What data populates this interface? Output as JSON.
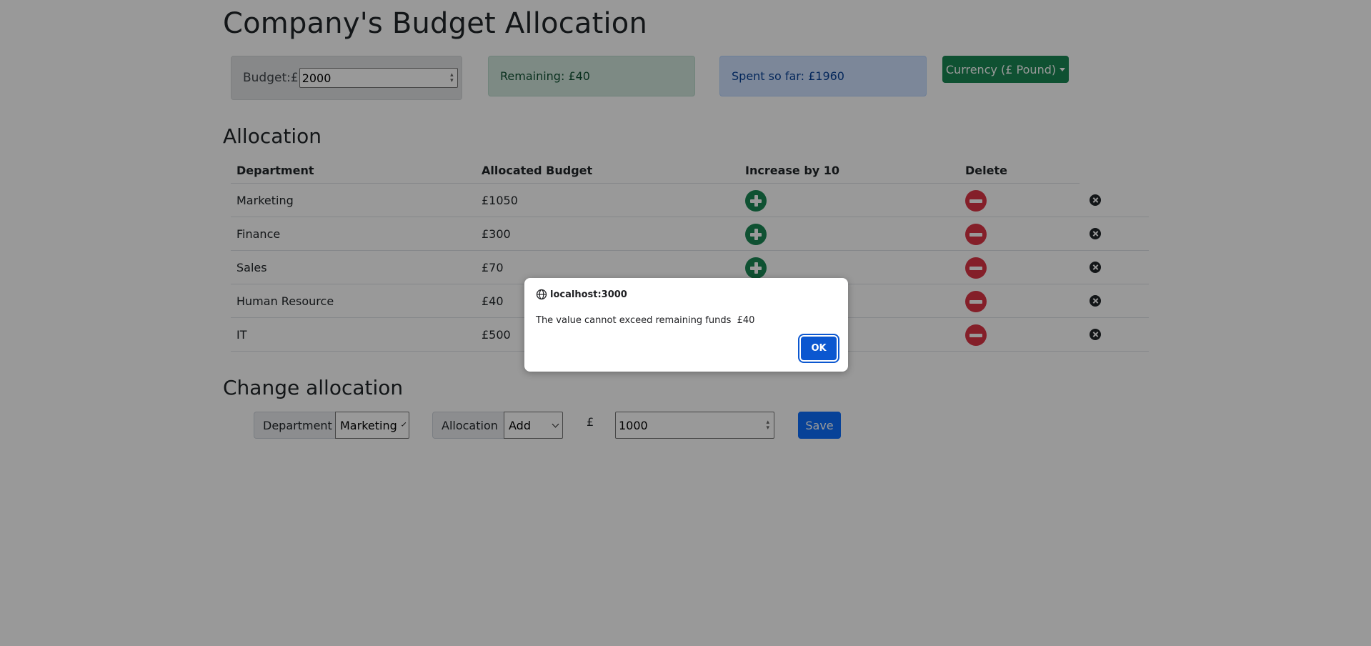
{
  "header": {
    "title": "Company's Budget Allocation"
  },
  "budget": {
    "label": "Budget:£",
    "value": "2000"
  },
  "remaining": {
    "text": "Remaining: £40"
  },
  "spent": {
    "text": "Spent so far: £1960"
  },
  "currency": {
    "label": "Currency (£ Pound)"
  },
  "allocation": {
    "title": "Allocation",
    "columns": [
      "Department",
      "Allocated Budget",
      "Increase by 10",
      "Delete"
    ],
    "rows": [
      {
        "department": "Marketing",
        "budget": "£1050"
      },
      {
        "department": "Finance",
        "budget": "£300"
      },
      {
        "department": "Sales",
        "budget": "£70"
      },
      {
        "department": "Human Resource",
        "budget": "£40"
      },
      {
        "department": "IT",
        "budget": "£500"
      }
    ]
  },
  "change": {
    "title": "Change allocation",
    "department_label": "Department",
    "department_value": "Marketing",
    "allocation_label": "Allocation",
    "allocation_value": "Add",
    "currency_symbol": "£",
    "amount_value": "1000",
    "save_label": "Save"
  },
  "dialog": {
    "origin": "localhost:3000",
    "message": "The value cannot exceed remaining funds  £40",
    "ok_label": "OK"
  },
  "colors": {
    "success": "#198754",
    "danger": "#dc3545",
    "primary": "#0d6efd",
    "dialog_button": "#0b57d0"
  },
  "icons": {
    "increase": "plus-circle-icon",
    "decrease": "minus-circle-icon",
    "delete": "x-circle-icon",
    "origin": "globe-icon"
  }
}
